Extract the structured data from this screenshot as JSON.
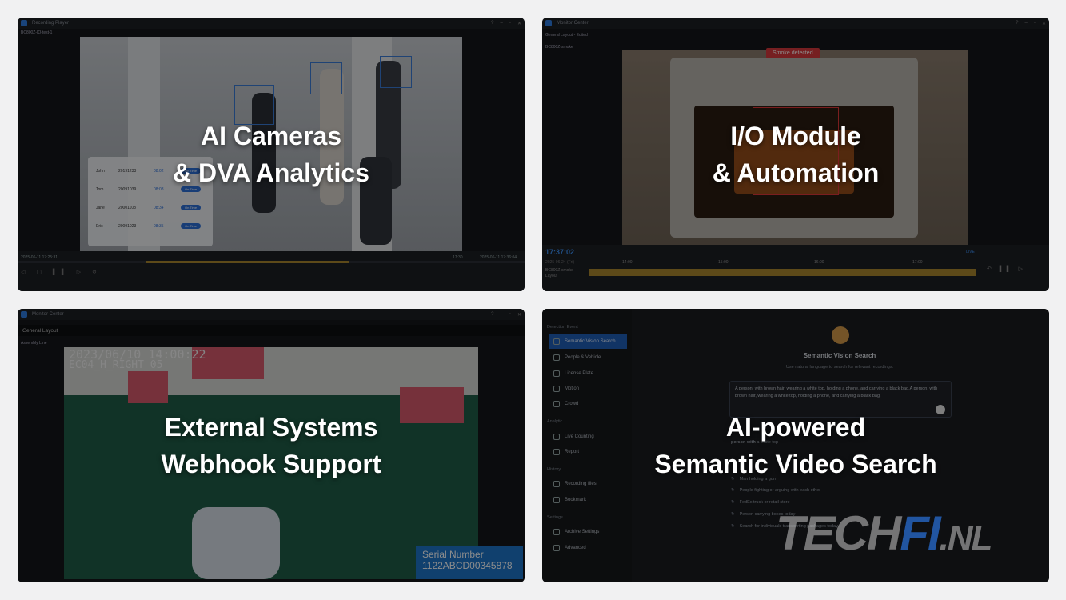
{
  "panels": [
    {
      "id": "ai-cameras",
      "overlay": {
        "line1": "AI Cameras",
        "line2": "& DVA Analytics"
      },
      "window_title": "Recording Player",
      "camera_label": "BC800Z-IQ-test-1",
      "time_start": "2025-06-11 17:25:31",
      "time_mid": "17:30",
      "time_end": "2025-06-11 17:36:04",
      "people": [
        {
          "name": "John",
          "id": "20191233",
          "time": "08:02",
          "status": "On Time"
        },
        {
          "name": "Tom",
          "id": "20091039",
          "time": "08:08",
          "status": "On Time"
        },
        {
          "name": "Jane",
          "id": "20001108",
          "time": "08:34",
          "status": "On Time"
        },
        {
          "name": "Eric",
          "id": "20091023",
          "time": "08:35",
          "status": "On Time"
        }
      ]
    },
    {
      "id": "io-module",
      "overlay": {
        "line1": "I/O Module",
        "line2": "& Automation"
      },
      "window_title": "Monitor Center",
      "layout_label": "General Layout - Edited",
      "camera_label": "BC800Z-smoke",
      "alert": "Smoke detected",
      "clock": "17:37:02",
      "date": "2025-06-24 (Fri)",
      "timeline_ticks": [
        "14:00",
        "15:00",
        "16:00",
        "17:00"
      ],
      "track_label": "BC800Z-smoke",
      "track_label2": "Layout",
      "live_label": "LIVE"
    },
    {
      "id": "external-systems",
      "overlay": {
        "line1": "External Systems",
        "line2": "Webhook Support"
      },
      "window_title": "Monitor Center",
      "layout_label": "General Layout",
      "camera_label": "Assembly Line",
      "osd_time": "2023/06/10 14:00:22",
      "osd_cam": "EC04_H_RIGHT_05",
      "serial_title": "Serial Number",
      "serial_value": "1122ABCD00345878"
    },
    {
      "id": "semantic-search",
      "overlay": {
        "line1": "AI-powered",
        "line2": "Semantic Video Search"
      },
      "sidebar": {
        "groups": [
          {
            "title": "Detection Event",
            "items": [
              "Semantic Vision Search",
              "People & Vehicle",
              "License Plate",
              "Motion",
              "Crowd"
            ]
          },
          {
            "title": "Analytic",
            "items": [
              "Live Counting",
              "Report"
            ]
          },
          {
            "title": "History",
            "items": [
              "Recording files",
              "Bookmark"
            ]
          },
          {
            "title": "Settings",
            "items": [
              "Archive Settings",
              "Advanced"
            ]
          }
        ]
      },
      "search_title": "Semantic Vision Search",
      "search_sub": "Use natural language to search for relevant recordings.",
      "query": "A person, with brown hair, wearing a white top, holding a phone, and carrying a black bag.A person, with brown hair, wearing a white top, holding a phone, and carrying a black bag.",
      "highlight_bold": "person with",
      "highlight_rest": "a white top",
      "suggestions": [
        "Man holding a gun",
        "People fighting or arguing with each other",
        "FedEx truck or retail store",
        "Person carrying boxes today",
        "Search for individuals transporting packages today"
      ],
      "watermark_a": "TECH",
      "watermark_b": "FI",
      "watermark_c": ".NL"
    }
  ],
  "colors": {
    "accent": "#2f7de1",
    "alert": "#e0383a",
    "page_bg": "#f1f1f2",
    "gold": "#a9872f"
  }
}
